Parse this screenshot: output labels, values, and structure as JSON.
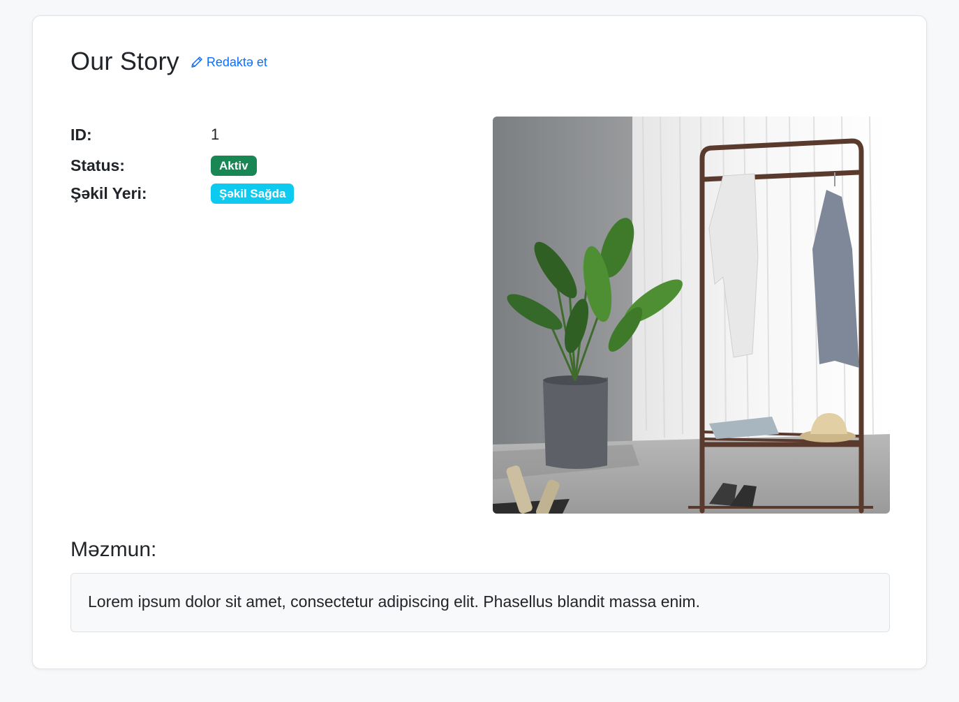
{
  "page": {
    "title": "Our Story",
    "edit_label": "Redaktə et"
  },
  "details": [
    {
      "label": "ID:",
      "value": "1"
    },
    {
      "label": "Status:",
      "value": "Aktiv"
    },
    {
      "label": "Şəkil Yeri:",
      "value": "Şəkil Sağda"
    }
  ],
  "badges": {
    "status_color": "#198754",
    "position_color": "#0dcaf0"
  },
  "content": {
    "heading": "Məzmun:",
    "text": "Lorem ipsum dolor sit amet, consectetur adipiscing elit. Phasellus blandit massa enim."
  },
  "colors": {
    "accent": "#0d6efd"
  },
  "icons": {
    "edit": "pencil-icon"
  }
}
